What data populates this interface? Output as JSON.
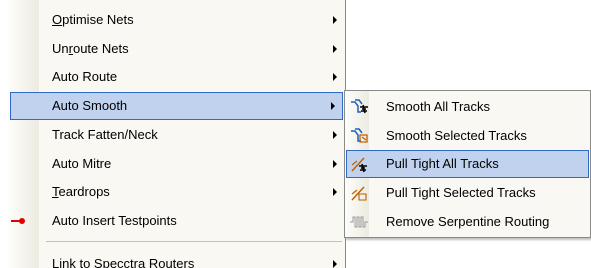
{
  "main_menu": {
    "items": [
      {
        "pre": "",
        "ul": "O",
        "post": "ptimise Nets",
        "has_submenu": true
      },
      {
        "pre": "Un",
        "ul": "r",
        "post": "oute Nets",
        "has_submenu": true
      },
      {
        "pre": "Auto Route",
        "ul": "",
        "post": "",
        "has_submenu": true
      },
      {
        "pre": "Auto Smooth",
        "ul": "",
        "post": "",
        "has_submenu": true,
        "highlighted": true
      },
      {
        "pre": "Track Fatten/Neck",
        "ul": "",
        "post": "",
        "has_submenu": true
      },
      {
        "pre": "Auto Mitre",
        "ul": "",
        "post": "",
        "has_submenu": true
      },
      {
        "pre": "",
        "ul": "T",
        "post": "eardrops",
        "has_submenu": true
      },
      {
        "pre": "Auto Insert Testpoints",
        "ul": "",
        "post": "",
        "has_submenu": false,
        "icon": "testpoint-icon"
      },
      {
        "pre": "Link to Specctra Routers",
        "ul": "",
        "post": "",
        "has_submenu": true
      }
    ]
  },
  "sub_menu": {
    "items": [
      {
        "label": "Smooth All Tracks",
        "icon": "smooth-all-tracks-icon"
      },
      {
        "label": "Smooth Selected Tracks",
        "icon": "smooth-selected-tracks-icon"
      },
      {
        "label": "Pull Tight All Tracks",
        "icon": "pull-tight-all-icon",
        "highlighted": true
      },
      {
        "label": "Pull Tight Selected Tracks",
        "icon": "pull-tight-selected-icon"
      },
      {
        "label": "Remove Serpentine Routing",
        "icon": "serpentine-icon"
      }
    ]
  },
  "colors": {
    "highlight_fill": "#c1d2ee",
    "highlight_border": "#316ac5",
    "menu_background": "#f9f8f3",
    "testpoint_red": "#e00000"
  }
}
